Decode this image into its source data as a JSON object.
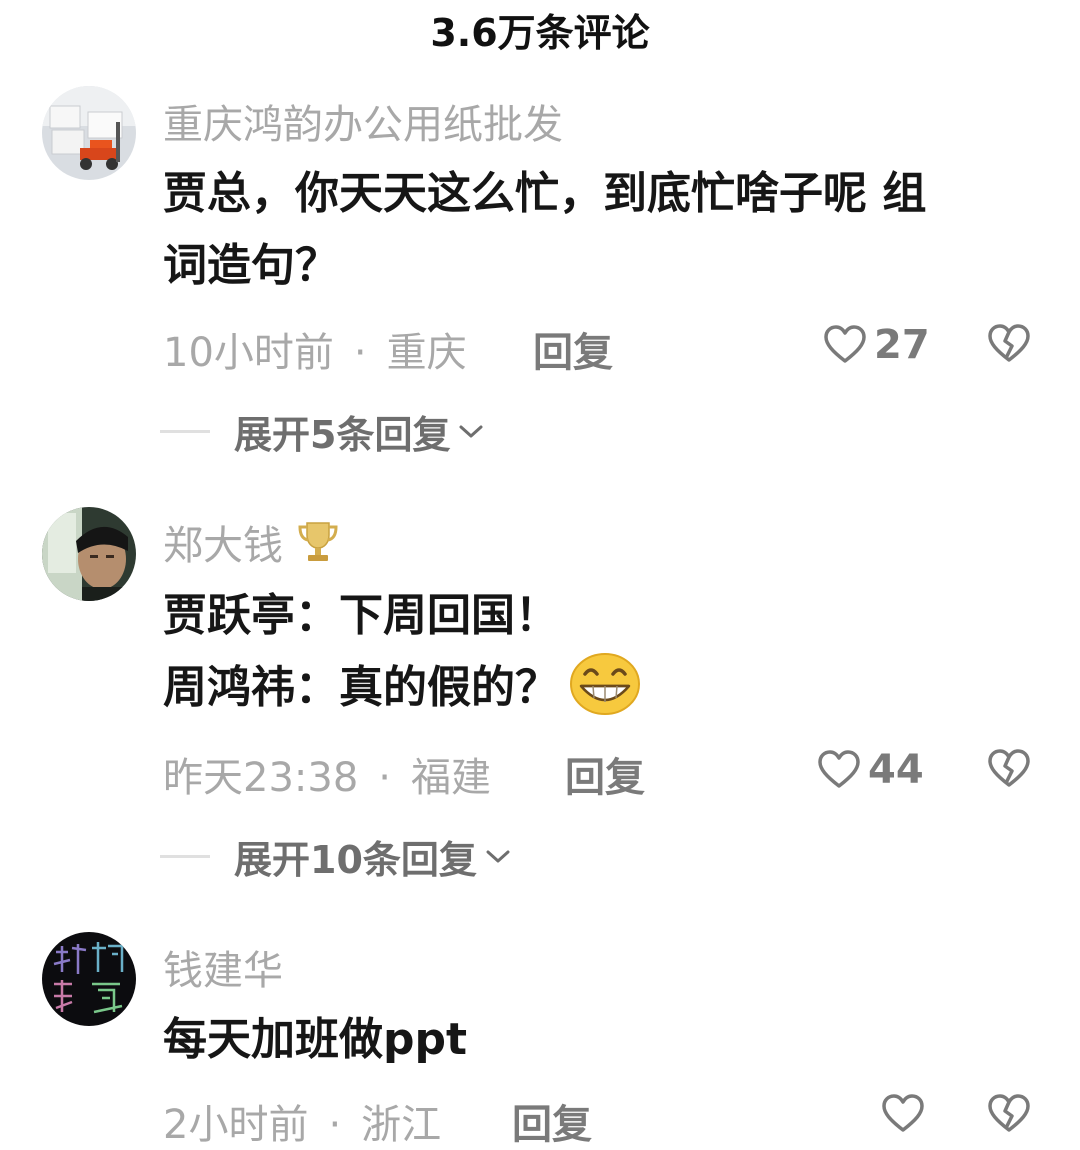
{
  "header": {
    "title": "3.6万条评论"
  },
  "comments": [
    {
      "username": "重庆鸿韵办公用纸批发",
      "content_lines": [
        "贾总，你天天这么忙，到底忙啥子呢  组",
        "词造句？"
      ],
      "time": "10小时前",
      "location": "重庆",
      "reply_label": "回复",
      "likes": "27",
      "expand_label": "展开5条回复"
    },
    {
      "username": "郑大钱",
      "content_lines": [
        "贾跃亭：下周回国！",
        "周鸿祎：真的假的？"
      ],
      "time": "昨天23:38",
      "location": "福建",
      "reply_label": "回复",
      "likes": "44",
      "expand_label": "展开10条回复"
    },
    {
      "username": "钱建华",
      "content_lines": [
        "每天加班做ppt"
      ],
      "time": "2小时前",
      "location": "浙江",
      "reply_label": "回复",
      "likes": ""
    }
  ],
  "separator": "·",
  "icons": {
    "like": "heart-outline-icon",
    "dislike": "broken-heart-icon",
    "expand": "chevron-down-icon",
    "badge": "trophy-icon",
    "emoji": "grinning-face-icon"
  },
  "colors": {
    "text_primary": "#161616",
    "text_secondary": "#a8a8a8",
    "text_action": "#7a7a7a",
    "background": "#ffffff"
  }
}
